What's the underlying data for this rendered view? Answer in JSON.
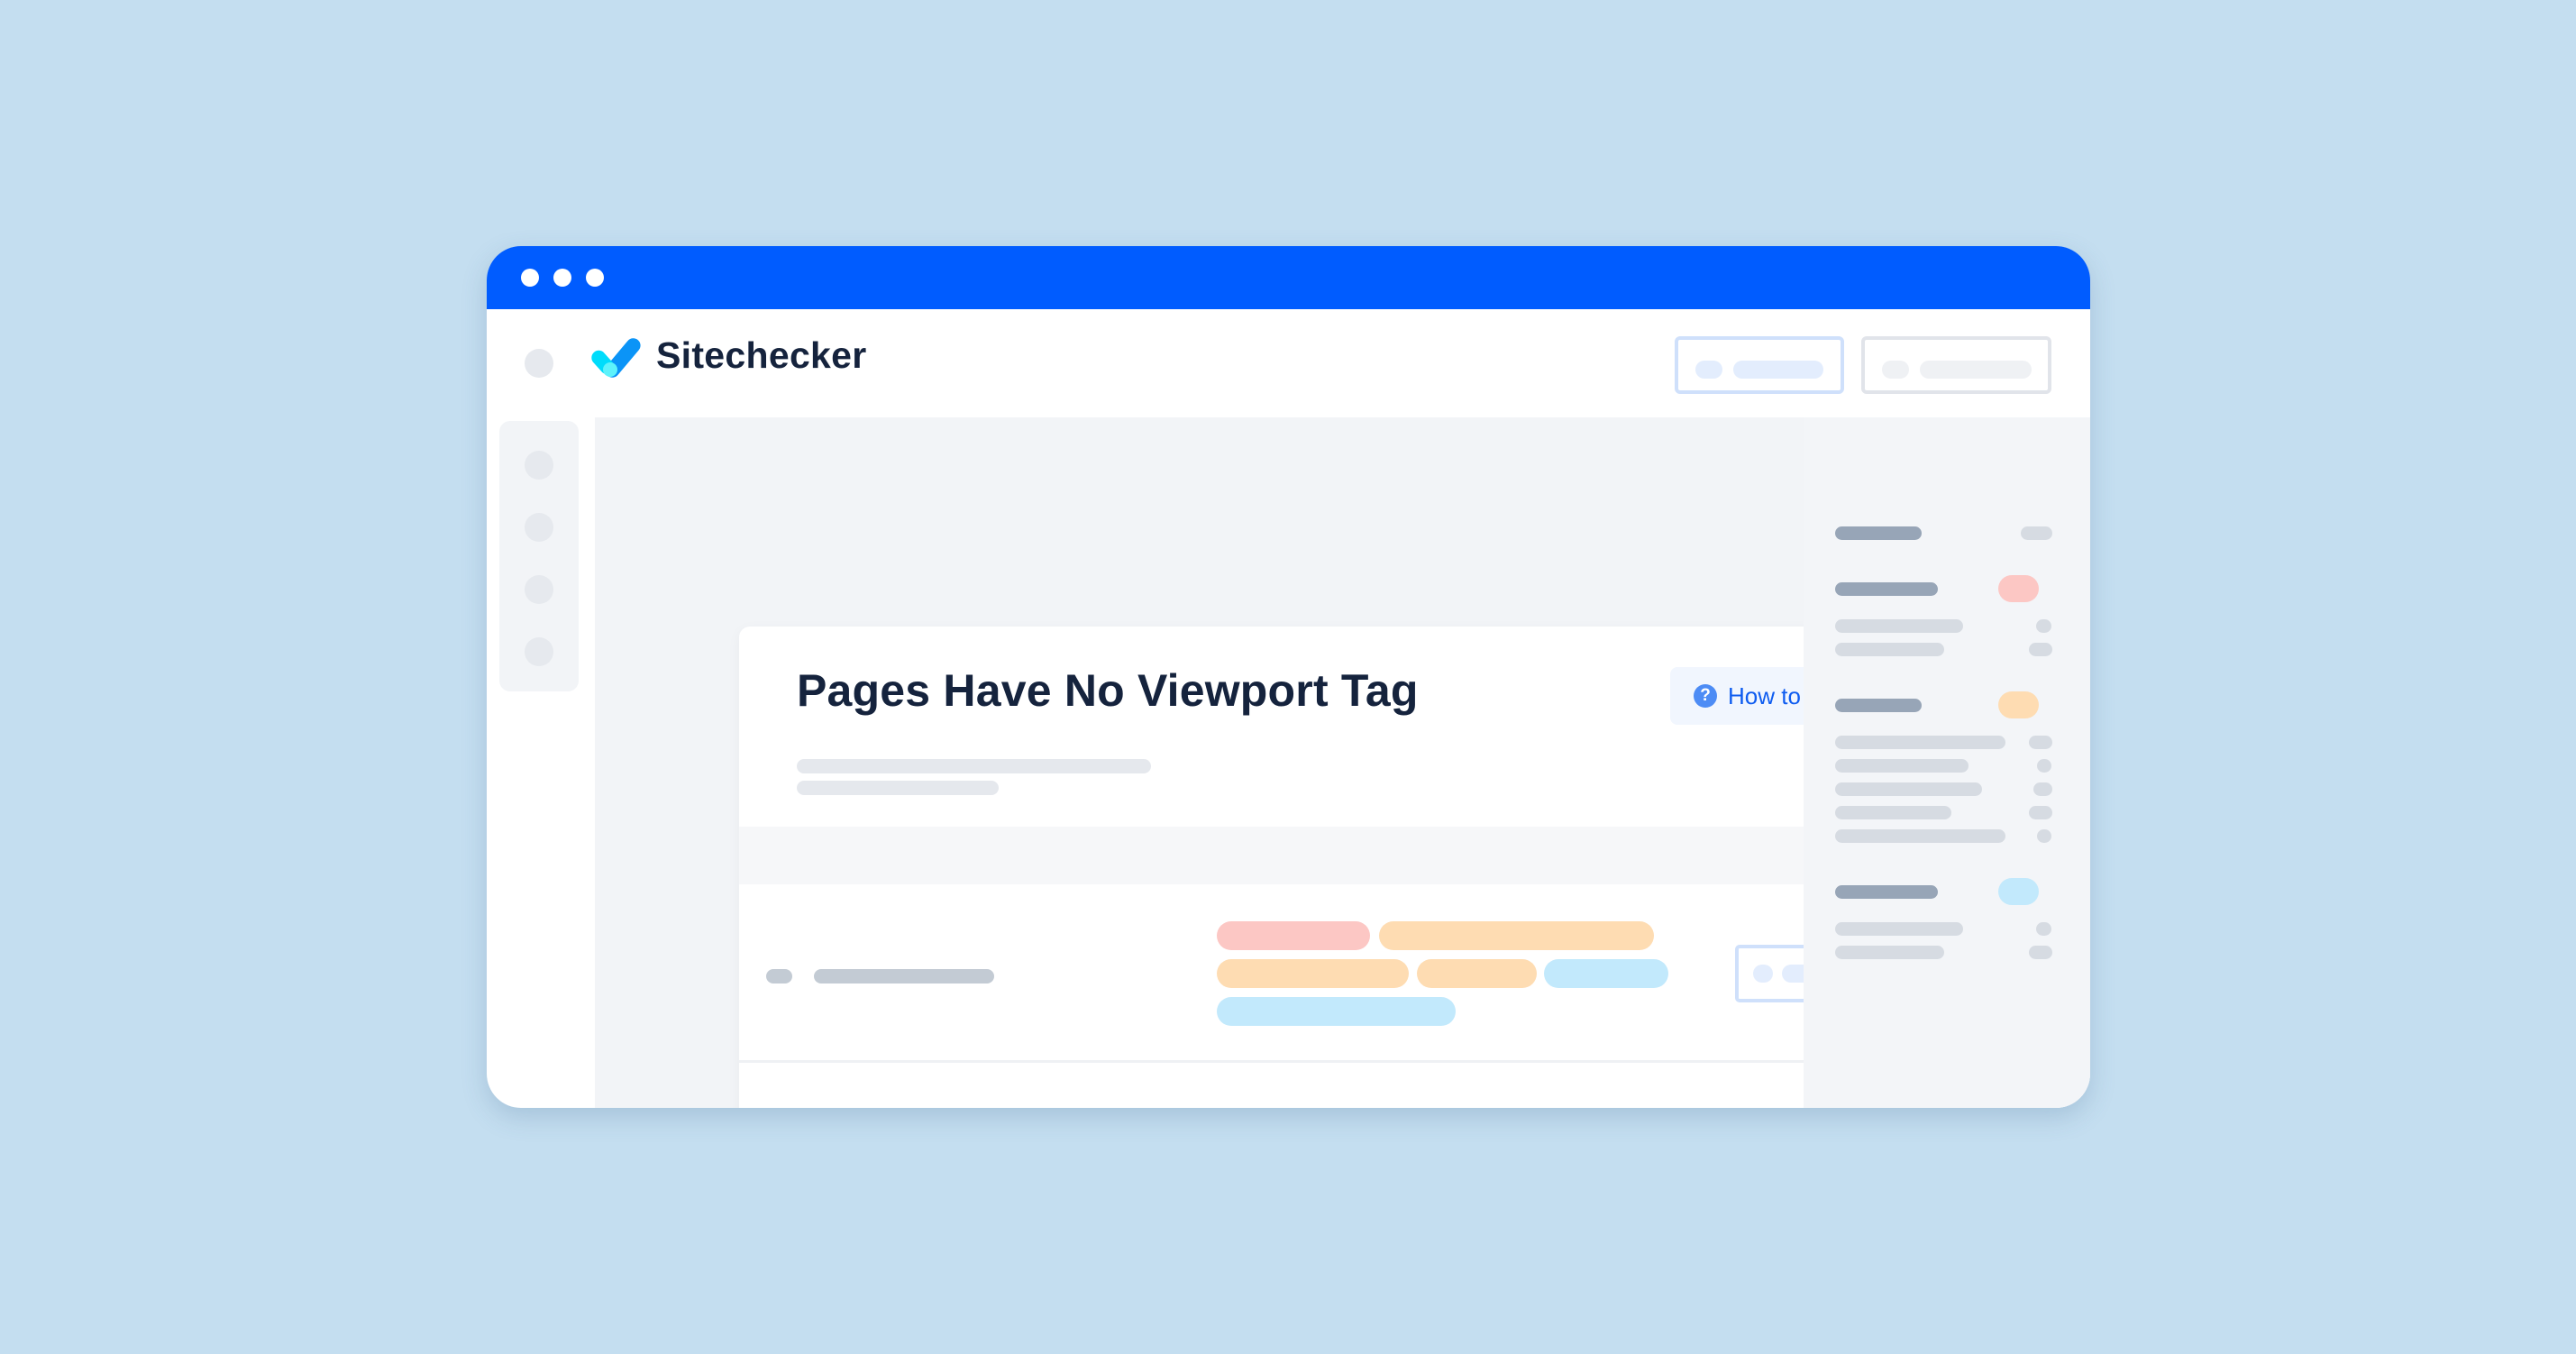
{
  "window": {
    "titlebar_color": "#005cff",
    "titlebar_dots": [
      "window-dot",
      "window-dot",
      "window-dot"
    ]
  },
  "header": {
    "brand": "Sitechecker",
    "logo_icon": "checkmark-logo-icon",
    "buttons": [
      {
        "name": "header-button-primary",
        "style": "blue-outline"
      },
      {
        "name": "header-button-secondary",
        "style": "gray-outline"
      }
    ]
  },
  "sidebar": {
    "items": [
      "nav-item",
      "nav-item",
      "nav-item",
      "nav-item"
    ]
  },
  "card": {
    "title": "Pages Have No Viewport Tag",
    "how_to_fix": {
      "label": "How to fix",
      "icon": "question-circle-icon",
      "icon_glyph": "?"
    },
    "rows": [
      {
        "tags": [
          [
            "red",
            "orange"
          ],
          [
            "orange",
            "orange",
            "blue"
          ],
          [
            "blue"
          ]
        ]
      },
      {
        "tags": [
          [
            "red",
            "red"
          ],
          [
            "orange",
            "orange"
          ]
        ]
      }
    ]
  },
  "right_panel": {
    "sections": [
      {
        "badge_color": null
      },
      {
        "badge_color": "#fcc7c4"
      },
      {
        "badge_color": "#fedcb2"
      },
      {
        "badge_color": "#c2e9fc"
      }
    ]
  },
  "colors": {
    "brand_blue": "#005cff",
    "link_blue": "#0e5cf0",
    "title_navy": "#15233d",
    "tag_red": "#fcc7c4",
    "tag_orange": "#fedcb2",
    "tag_blue": "#c2e9fc",
    "background": "#c4def0"
  }
}
